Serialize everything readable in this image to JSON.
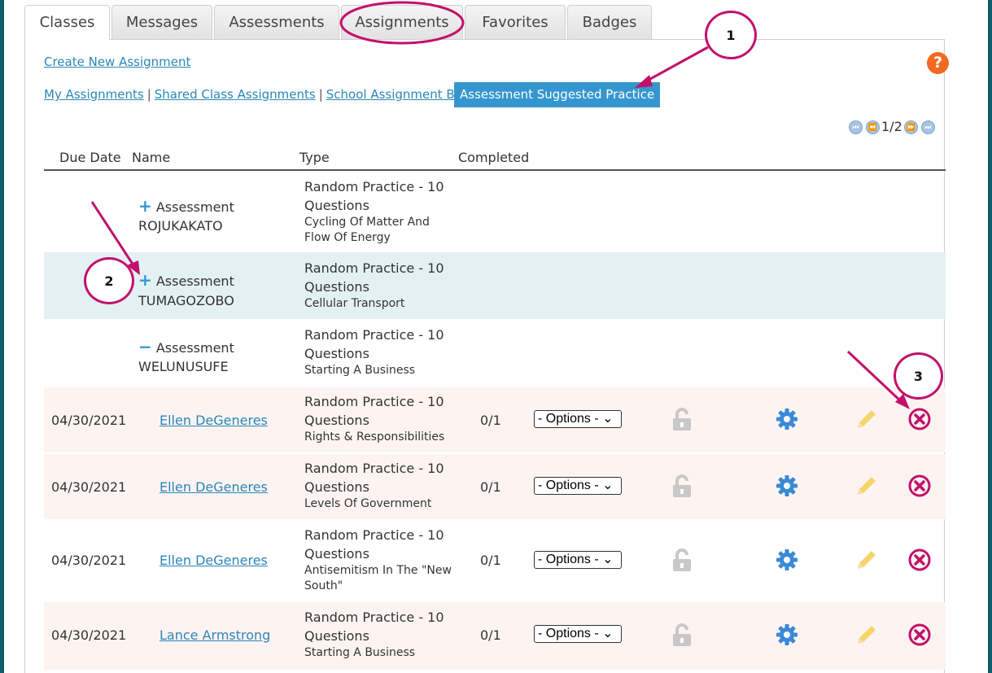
{
  "tabs": [
    "Classes",
    "Messages",
    "Assessments",
    "Assignments",
    "Favorites",
    "Badges"
  ],
  "create_link": "Create New Assignment",
  "help_label": "?",
  "subnav": {
    "my": "My Assignments",
    "shared": "Shared Class Assignments",
    "bank": "School Assignment Bank",
    "sep": "|",
    "active": "Assessment Suggested Practice"
  },
  "pager": {
    "text": "1/2"
  },
  "columns": {
    "due": "Due Date",
    "name": "Name",
    "type": "Type",
    "completed": "Completed"
  },
  "groups": [
    {
      "toggle": "+",
      "label": "Assessment",
      "code": "ROJUKAKATO",
      "type1": "Random Practice - 10",
      "type2": "Questions",
      "topic": "Cycling Of Matter And",
      "topic2": "Flow Of Energy"
    },
    {
      "toggle": "+",
      "label": "Assessment",
      "code": "TUMAGOZOBO",
      "type1": "Random Practice - 10",
      "type2": "Questions",
      "topic": "Cellular Transport",
      "topic2": ""
    },
    {
      "toggle": "−",
      "label": "Assessment",
      "code": "WELUNUSUFE",
      "type1": "Random Practice - 10",
      "type2": "Questions",
      "topic": "Starting A Business",
      "topic2": ""
    }
  ],
  "assignments": [
    {
      "due": "04/30/2021",
      "name": "Ellen DeGeneres",
      "type1": "Random Practice - 10",
      "type2": "Questions",
      "topic": "Rights & Responsibilities",
      "topic2": "",
      "completed": "0/1",
      "options": "- Options -"
    },
    {
      "due": "04/30/2021",
      "name": "Ellen DeGeneres",
      "type1": "Random Practice - 10",
      "type2": "Questions",
      "topic": "Levels Of Government",
      "topic2": "",
      "completed": "0/1",
      "options": "- Options -"
    },
    {
      "due": "04/30/2021",
      "name": "Ellen DeGeneres",
      "type1": "Random Practice - 10",
      "type2": "Questions",
      "topic": "Antisemitism In The \"New",
      "topic2": "South\"",
      "completed": "0/1",
      "options": "- Options -"
    },
    {
      "due": "04/30/2021",
      "name": "Lance Armstrong",
      "type1": "Random Practice - 10",
      "type2": "Questions",
      "topic": "Starting A Business",
      "topic2": "",
      "completed": "0/1",
      "options": "- Options -"
    }
  ],
  "icons": {
    "lock": "lock-icon",
    "settings": "gear-icon",
    "edit": "pencil-icon",
    "delete": "delete-x-icon",
    "pager": [
      "first-page-icon",
      "prev-page-icon",
      "next-page-icon",
      "last-page-icon"
    ]
  },
  "annotations": [
    "1",
    "2",
    "3"
  ],
  "colors": {
    "accent": "#3596cf",
    "annotation": "#c2106b",
    "help": "#f26a22",
    "delete": "#c2106b",
    "edit": "#f5d66b",
    "gear": "#3a8ad6",
    "lock": "#c8c8c8"
  }
}
